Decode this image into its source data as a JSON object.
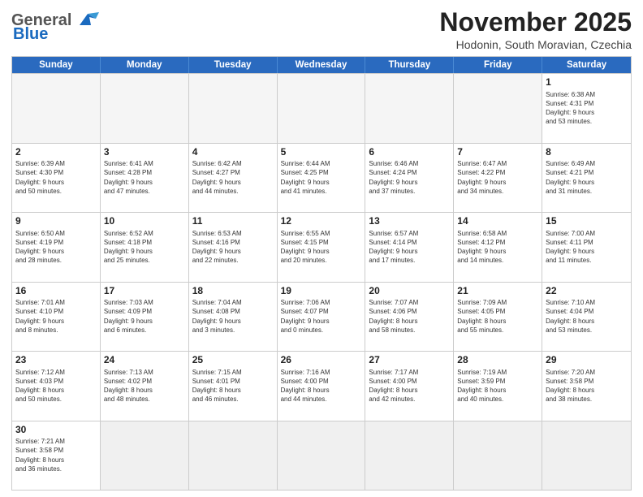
{
  "logo": {
    "line1": "General",
    "line2": "Blue"
  },
  "title": "November 2025",
  "subtitle": "Hodonin, South Moravian, Czechia",
  "weekdays": [
    "Sunday",
    "Monday",
    "Tuesday",
    "Wednesday",
    "Thursday",
    "Friday",
    "Saturday"
  ],
  "weeks": [
    [
      {
        "day": "",
        "info": ""
      },
      {
        "day": "",
        "info": ""
      },
      {
        "day": "",
        "info": ""
      },
      {
        "day": "",
        "info": ""
      },
      {
        "day": "",
        "info": ""
      },
      {
        "day": "",
        "info": ""
      },
      {
        "day": "1",
        "info": "Sunrise: 6:38 AM\nSunset: 4:31 PM\nDaylight: 9 hours\nand 53 minutes."
      }
    ],
    [
      {
        "day": "2",
        "info": "Sunrise: 6:39 AM\nSunset: 4:30 PM\nDaylight: 9 hours\nand 50 minutes."
      },
      {
        "day": "3",
        "info": "Sunrise: 6:41 AM\nSunset: 4:28 PM\nDaylight: 9 hours\nand 47 minutes."
      },
      {
        "day": "4",
        "info": "Sunrise: 6:42 AM\nSunset: 4:27 PM\nDaylight: 9 hours\nand 44 minutes."
      },
      {
        "day": "5",
        "info": "Sunrise: 6:44 AM\nSunset: 4:25 PM\nDaylight: 9 hours\nand 41 minutes."
      },
      {
        "day": "6",
        "info": "Sunrise: 6:46 AM\nSunset: 4:24 PM\nDaylight: 9 hours\nand 37 minutes."
      },
      {
        "day": "7",
        "info": "Sunrise: 6:47 AM\nSunset: 4:22 PM\nDaylight: 9 hours\nand 34 minutes."
      },
      {
        "day": "8",
        "info": "Sunrise: 6:49 AM\nSunset: 4:21 PM\nDaylight: 9 hours\nand 31 minutes."
      }
    ],
    [
      {
        "day": "9",
        "info": "Sunrise: 6:50 AM\nSunset: 4:19 PM\nDaylight: 9 hours\nand 28 minutes."
      },
      {
        "day": "10",
        "info": "Sunrise: 6:52 AM\nSunset: 4:18 PM\nDaylight: 9 hours\nand 25 minutes."
      },
      {
        "day": "11",
        "info": "Sunrise: 6:53 AM\nSunset: 4:16 PM\nDaylight: 9 hours\nand 22 minutes."
      },
      {
        "day": "12",
        "info": "Sunrise: 6:55 AM\nSunset: 4:15 PM\nDaylight: 9 hours\nand 20 minutes."
      },
      {
        "day": "13",
        "info": "Sunrise: 6:57 AM\nSunset: 4:14 PM\nDaylight: 9 hours\nand 17 minutes."
      },
      {
        "day": "14",
        "info": "Sunrise: 6:58 AM\nSunset: 4:12 PM\nDaylight: 9 hours\nand 14 minutes."
      },
      {
        "day": "15",
        "info": "Sunrise: 7:00 AM\nSunset: 4:11 PM\nDaylight: 9 hours\nand 11 minutes."
      }
    ],
    [
      {
        "day": "16",
        "info": "Sunrise: 7:01 AM\nSunset: 4:10 PM\nDaylight: 9 hours\nand 8 minutes."
      },
      {
        "day": "17",
        "info": "Sunrise: 7:03 AM\nSunset: 4:09 PM\nDaylight: 9 hours\nand 6 minutes."
      },
      {
        "day": "18",
        "info": "Sunrise: 7:04 AM\nSunset: 4:08 PM\nDaylight: 9 hours\nand 3 minutes."
      },
      {
        "day": "19",
        "info": "Sunrise: 7:06 AM\nSunset: 4:07 PM\nDaylight: 9 hours\nand 0 minutes."
      },
      {
        "day": "20",
        "info": "Sunrise: 7:07 AM\nSunset: 4:06 PM\nDaylight: 8 hours\nand 58 minutes."
      },
      {
        "day": "21",
        "info": "Sunrise: 7:09 AM\nSunset: 4:05 PM\nDaylight: 8 hours\nand 55 minutes."
      },
      {
        "day": "22",
        "info": "Sunrise: 7:10 AM\nSunset: 4:04 PM\nDaylight: 8 hours\nand 53 minutes."
      }
    ],
    [
      {
        "day": "23",
        "info": "Sunrise: 7:12 AM\nSunset: 4:03 PM\nDaylight: 8 hours\nand 50 minutes."
      },
      {
        "day": "24",
        "info": "Sunrise: 7:13 AM\nSunset: 4:02 PM\nDaylight: 8 hours\nand 48 minutes."
      },
      {
        "day": "25",
        "info": "Sunrise: 7:15 AM\nSunset: 4:01 PM\nDaylight: 8 hours\nand 46 minutes."
      },
      {
        "day": "26",
        "info": "Sunrise: 7:16 AM\nSunset: 4:00 PM\nDaylight: 8 hours\nand 44 minutes."
      },
      {
        "day": "27",
        "info": "Sunrise: 7:17 AM\nSunset: 4:00 PM\nDaylight: 8 hours\nand 42 minutes."
      },
      {
        "day": "28",
        "info": "Sunrise: 7:19 AM\nSunset: 3:59 PM\nDaylight: 8 hours\nand 40 minutes."
      },
      {
        "day": "29",
        "info": "Sunrise: 7:20 AM\nSunset: 3:58 PM\nDaylight: 8 hours\nand 38 minutes."
      }
    ],
    [
      {
        "day": "30",
        "info": "Sunrise: 7:21 AM\nSunset: 3:58 PM\nDaylight: 8 hours\nand 36 minutes."
      },
      {
        "day": "",
        "info": ""
      },
      {
        "day": "",
        "info": ""
      },
      {
        "day": "",
        "info": ""
      },
      {
        "day": "",
        "info": ""
      },
      {
        "day": "",
        "info": ""
      },
      {
        "day": "",
        "info": ""
      }
    ]
  ]
}
